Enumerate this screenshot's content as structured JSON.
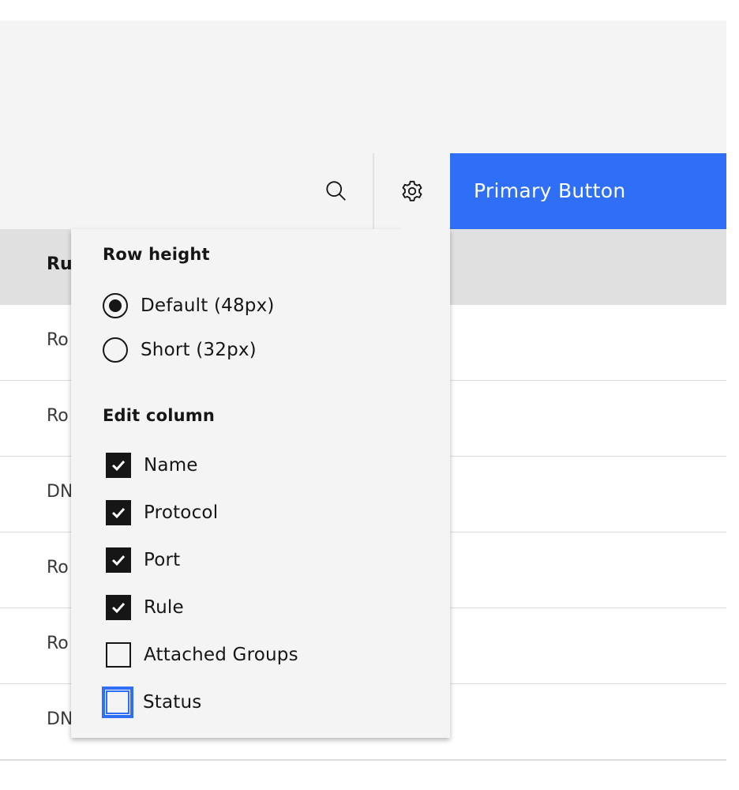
{
  "toolbar": {
    "search_icon": "search-icon",
    "settings_icon": "gear-icon",
    "primary_button_label": "Primary Button",
    "accent_color": "#2f6ef6"
  },
  "table": {
    "header": "Ru",
    "rows": [
      "Ro",
      "Ro",
      "DN",
      "Ro",
      "Ro",
      "DN"
    ]
  },
  "popover": {
    "row_height": {
      "title": "Row height",
      "options": [
        {
          "label": "Default (48px)",
          "selected": true
        },
        {
          "label": "Short (32px)",
          "selected": false
        }
      ]
    },
    "edit_column": {
      "title": "Edit column",
      "options": [
        {
          "label": "Name",
          "checked": true
        },
        {
          "label": "Protocol",
          "checked": true
        },
        {
          "label": "Port",
          "checked": true
        },
        {
          "label": "Rule",
          "checked": true
        },
        {
          "label": "Attached Groups",
          "checked": false
        },
        {
          "label": "Status",
          "checked": false,
          "focused": true
        }
      ]
    }
  }
}
